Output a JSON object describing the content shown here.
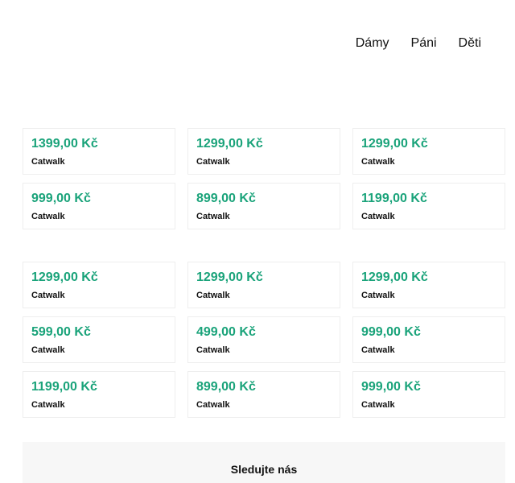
{
  "nav": {
    "items": [
      {
        "label": "Dámy"
      },
      {
        "label": "Páni"
      },
      {
        "label": "Děti"
      }
    ]
  },
  "products": {
    "section1": [
      {
        "price": "1399,00 Kč",
        "brand": "Catwalk"
      },
      {
        "price": "1299,00 Kč",
        "brand": "Catwalk"
      },
      {
        "price": "1299,00 Kč",
        "brand": "Catwalk"
      },
      {
        "price": "999,00 Kč",
        "brand": "Catwalk"
      },
      {
        "price": "899,00 Kč",
        "brand": "Catwalk"
      },
      {
        "price": "1199,00 Kč",
        "brand": "Catwalk"
      }
    ],
    "section2": [
      {
        "price": "1299,00 Kč",
        "brand": "Catwalk"
      },
      {
        "price": "1299,00 Kč",
        "brand": "Catwalk"
      },
      {
        "price": "1299,00 Kč",
        "brand": "Catwalk"
      },
      {
        "price": "599,00 Kč",
        "brand": "Catwalk"
      },
      {
        "price": "499,00 Kč",
        "brand": "Catwalk"
      },
      {
        "price": "999,00 Kč",
        "brand": "Catwalk"
      },
      {
        "price": "1199,00 Kč",
        "brand": "Catwalk"
      },
      {
        "price": "899,00 Kč",
        "brand": "Catwalk"
      },
      {
        "price": "999,00 Kč",
        "brand": "Catwalk"
      }
    ]
  },
  "footer": {
    "title": "Sledujte nás"
  },
  "colors": {
    "price": "#1aa37a",
    "card_border": "#eeeeee",
    "footer_bg": "#f7f7f7"
  }
}
